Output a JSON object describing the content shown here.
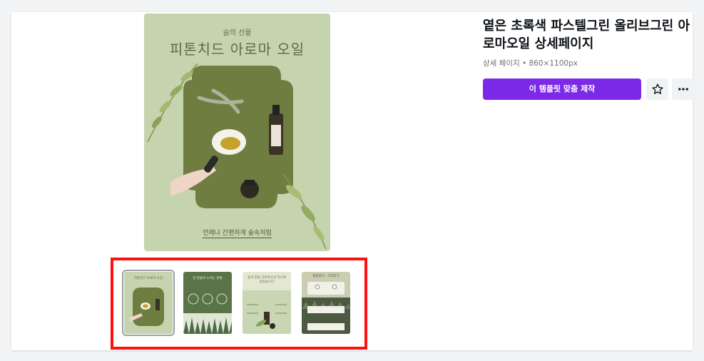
{
  "template": {
    "title": "옅은 초록색 파스텔그린 올리브그린 아로마오일 상세페이지",
    "meta": "상세 페이지 • 860×1100px",
    "cta_label": "이 템플릿 맞춤 제작",
    "icons": [
      "star-icon",
      "more-icon"
    ]
  },
  "preview": {
    "subtitle": "숨의 선물",
    "headline": "피톤치드 아로마 오일",
    "caption": "언제나 간편하게 숲속처럼"
  },
  "thumbnails": [
    {
      "label": "피톤치드 아로마 오일",
      "selected": true
    },
    {
      "label": "한 방울로 느끼는 변화",
      "selected": false
    },
    {
      "label": "숲의 향을 아로마오일 하나에 담았습니다",
      "selected": false
    },
    {
      "label": "제품정보 · 고객후기",
      "selected": false
    }
  ],
  "colors": {
    "accent": "#7d2ae8",
    "highlight_border": "#ff1010",
    "preview_bg": "#c5d4ae"
  }
}
